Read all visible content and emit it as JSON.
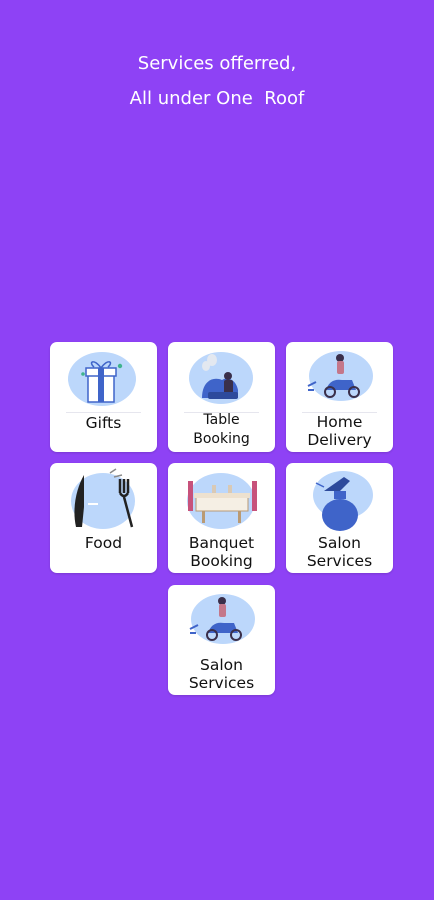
{
  "header": {
    "line1": "Services offerred,",
    "line2": "All under One  Roof"
  },
  "colors": {
    "background": "#8e42f5",
    "tile": "#ffffff",
    "blob": "#bcd7fb",
    "accent": "#3f64c9"
  },
  "services": [
    {
      "label": "Gifts",
      "icon": "gift-icon"
    },
    {
      "label_1": "Table",
      "label_2": "Booking",
      "icon": "table-booking-icon"
    },
    {
      "label_1": "Home",
      "label_2": "Delivery",
      "icon": "scooter-delivery-icon"
    },
    {
      "label": "Food",
      "icon": "knife-fork-icon"
    },
    {
      "label_1": "Banquet",
      "label_2": "Booking",
      "icon": "banquet-table-icon"
    },
    {
      "label_1": "Salon",
      "label_2": "Services",
      "icon": "spray-bottle-icon"
    },
    {
      "label_1": "Salon",
      "label_2": "Services",
      "icon": "scooter-delivery-icon"
    }
  ]
}
